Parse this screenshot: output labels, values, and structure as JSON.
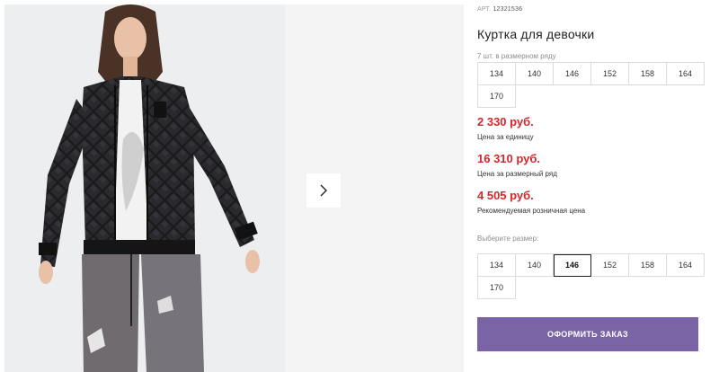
{
  "product": {
    "art_label": "АРТ.",
    "art_number": "12321536",
    "title": "Куртка для девочки"
  },
  "size_row": {
    "note": "7 шт. в размерном ряду",
    "sizes": [
      "134",
      "140",
      "146",
      "152",
      "158",
      "164",
      "170"
    ]
  },
  "prices": {
    "unit_price": "2 330 руб.",
    "unit_label": "Цена за единицу",
    "row_price": "16 310 руб.",
    "row_label": "Цена за размерный ряд",
    "retail_price": "4 505 руб.",
    "retail_label": "Рекомендуемая розничная цена"
  },
  "size_select": {
    "label": "Выберите размер:",
    "sizes": [
      "134",
      "140",
      "146",
      "152",
      "158",
      "164",
      "170"
    ],
    "selected": "146"
  },
  "order_button": {
    "label": "ОФОРМИТЬ ЗАКАЗ"
  },
  "colors": {
    "price": "#d8262c",
    "accent": "#7b64a6"
  },
  "icons": {
    "next": "chevron-right-icon"
  }
}
